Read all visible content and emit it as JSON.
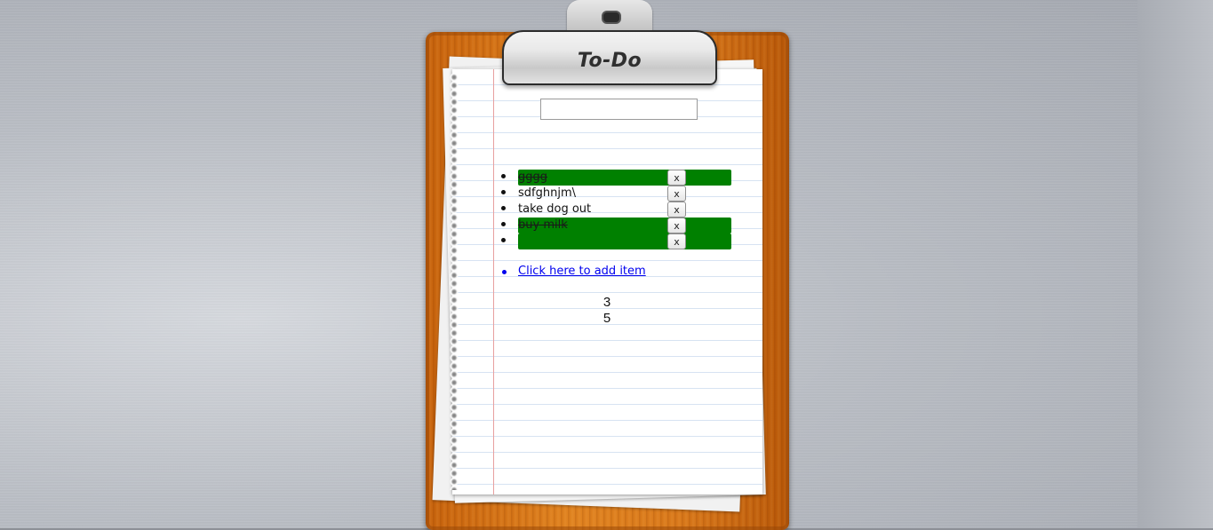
{
  "app": {
    "title": "To-Do"
  },
  "input": {
    "value": "",
    "placeholder": ""
  },
  "todos": [
    {
      "text": "gggg",
      "done": true,
      "remove_label": "x"
    },
    {
      "text": "sdfghnjm\\",
      "done": false,
      "remove_label": "x"
    },
    {
      "text": "take dog out",
      "done": false,
      "remove_label": "x"
    },
    {
      "text": "buy milk",
      "done": true,
      "remove_label": "x"
    },
    {
      "text": "",
      "done": true,
      "remove_label": "x"
    }
  ],
  "add_link": {
    "label": "Click here to add item"
  },
  "counts": {
    "remaining": "3",
    "total": "5"
  },
  "colors": {
    "done_highlight": "#008000",
    "link": "#0000ee",
    "board_wood": "#e0821f"
  }
}
